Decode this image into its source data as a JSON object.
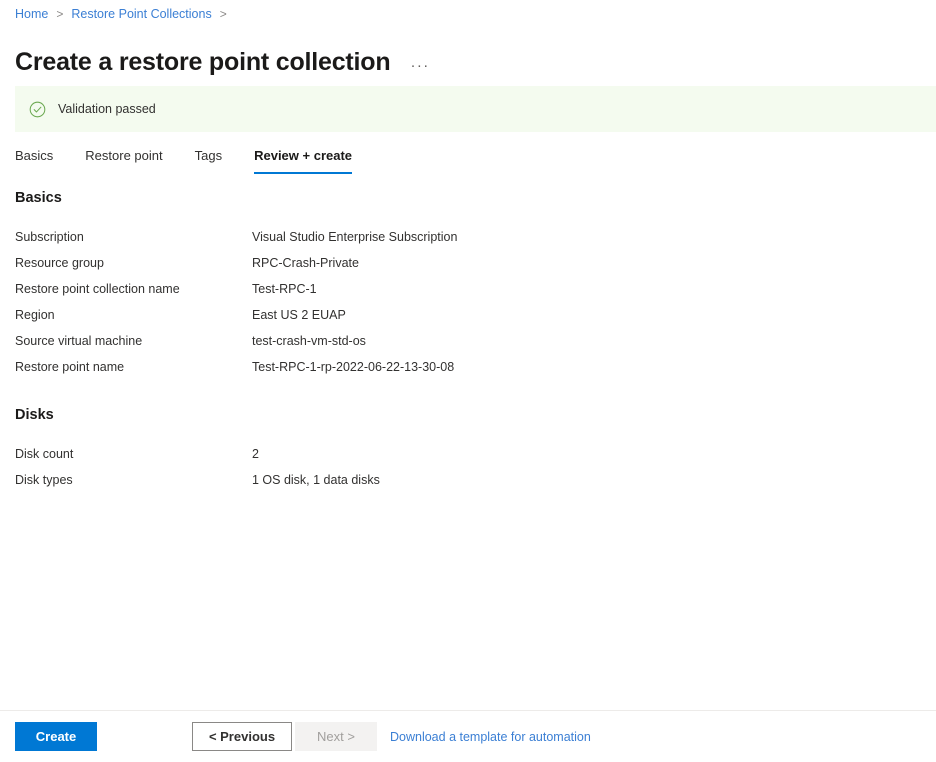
{
  "breadcrumb": {
    "items": [
      {
        "label": "Home"
      },
      {
        "label": "Restore Point Collections"
      }
    ],
    "separator": ">"
  },
  "header": {
    "title": "Create a restore point collection",
    "more_menu_label": "···"
  },
  "validation": {
    "message": "Validation passed",
    "icon": "check-circle-icon",
    "background_color": "#f4fbef",
    "icon_color": "#6aa84f"
  },
  "tabs": [
    {
      "label": "Basics",
      "active": false
    },
    {
      "label": "Restore point",
      "active": false
    },
    {
      "label": "Tags",
      "active": false
    },
    {
      "label": "Review + create",
      "active": true
    }
  ],
  "sections": [
    {
      "heading": "Basics",
      "rows": [
        {
          "label": "Subscription",
          "value": "Visual Studio Enterprise Subscription"
        },
        {
          "label": "Resource group",
          "value": "RPC-Crash-Private"
        },
        {
          "label": "Restore point collection name",
          "value": "Test-RPC-1"
        },
        {
          "label": "Region",
          "value": "East US 2 EUAP"
        },
        {
          "label": "Source virtual machine",
          "value": "test-crash-vm-std-os"
        },
        {
          "label": "Restore point name",
          "value": "Test-RPC-1-rp-2022-06-22-13-30-08"
        }
      ]
    },
    {
      "heading": "Disks",
      "rows": [
        {
          "label": "Disk count",
          "value": "2"
        },
        {
          "label": "Disk types",
          "value": "1 OS disk, 1 data disks"
        }
      ]
    }
  ],
  "footer": {
    "create_label": "Create",
    "previous_label": "< Previous",
    "next_label": "Next >",
    "download_template_label": "Download a template for automation"
  },
  "colors": {
    "accent": "#0078d4",
    "link": "#3b7fd4",
    "success": "#6aa84f",
    "disabled_bg": "#f3f2f1",
    "disabled_text": "#a19f9d"
  }
}
